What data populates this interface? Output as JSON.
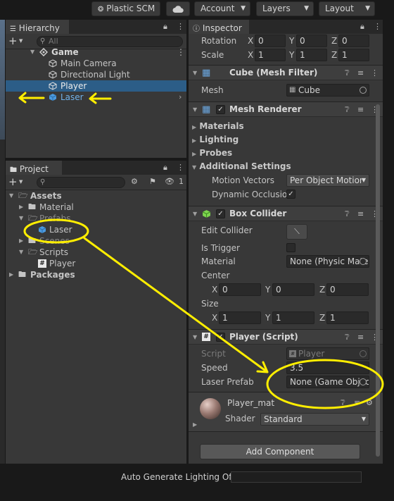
{
  "topbar": {
    "plastic": "Plastic SCM",
    "account": "Account",
    "layers": "Layers",
    "layout": "Layout"
  },
  "hierarchy": {
    "tab": "Hierarchy",
    "search_placeholder": "All",
    "scene": "Game",
    "items": [
      "Main Camera",
      "Directional Light",
      "Player",
      "Laser"
    ]
  },
  "project": {
    "tab": "Project",
    "count": "1",
    "tree": {
      "assets": "Assets",
      "material": "Material",
      "prefabs": "Prefabs",
      "laser": "Laser",
      "scenes": "Scenes",
      "scripts": "Scripts",
      "player": "Player",
      "packages": "Packages"
    }
  },
  "inspector": {
    "tab": "Inspector",
    "transform": {
      "rotation_label": "Rotation",
      "rotation": {
        "x": "0",
        "y": "0",
        "z": "0"
      },
      "scale_label": "Scale",
      "scale": {
        "x": "1",
        "y": "1",
        "z": "1"
      }
    },
    "mesh_filter": {
      "title": "Cube (Mesh Filter)",
      "mesh_label": "Mesh",
      "mesh_value": "Cube"
    },
    "mesh_renderer": {
      "title": "Mesh Renderer",
      "sections": [
        "Materials",
        "Lighting",
        "Probes",
        "Additional Settings"
      ],
      "motion_label": "Motion Vectors",
      "motion_value": "Per Object Motion",
      "occlusion_label": "Dynamic Occlusion"
    },
    "box_collider": {
      "title": "Box Collider",
      "edit_label": "Edit Collider",
      "trigger_label": "Is Trigger",
      "material_label": "Material",
      "material_value": "None (Physic Material)",
      "center_label": "Center",
      "center": {
        "x": "0",
        "y": "0",
        "z": "0"
      },
      "size_label": "Size",
      "size": {
        "x": "1",
        "y": "1",
        "z": "1"
      }
    },
    "player_script": {
      "title": "Player (Script)",
      "script_label": "Script",
      "script_value": "Player",
      "speed_label": "Speed",
      "speed_value": "3.5",
      "prefab_label": "Laser Prefab",
      "prefab_value": "None (Game Object)"
    },
    "material": {
      "name": "Player_mat",
      "shader_label": "Shader",
      "shader_value": "Standard"
    },
    "add_component": "Add Component"
  },
  "status": {
    "text": "Auto Generate Lighting Off"
  },
  "colors": {
    "annotation": "#ffee00",
    "selection": "#2c5d87",
    "hierarchy_blue": "#4a9ae0"
  }
}
